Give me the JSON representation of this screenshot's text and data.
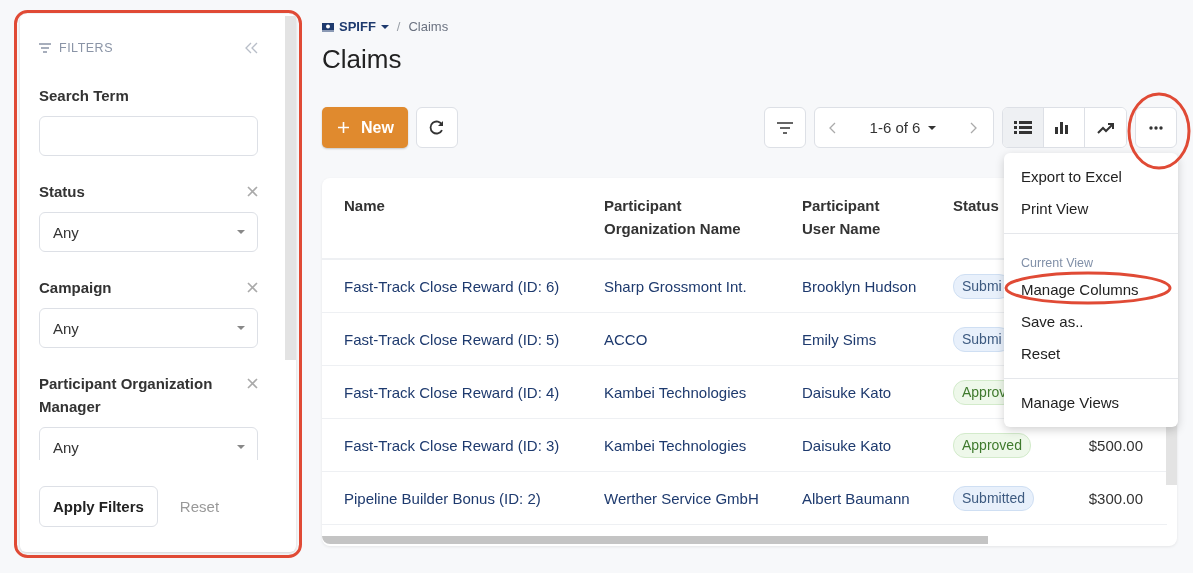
{
  "filters": {
    "title": "FILTERS",
    "fields": [
      {
        "label": "Search Term",
        "kind": "text",
        "clearable": false
      },
      {
        "label": "Status",
        "kind": "select",
        "value": "Any",
        "clearable": true
      },
      {
        "label": "Campaign",
        "kind": "select",
        "value": "Any",
        "clearable": true
      },
      {
        "label": "Participant Organization Manager",
        "kind": "select",
        "value": "Any",
        "clearable": true
      }
    ],
    "apply_button": "Apply Filters",
    "reset_button": "Reset"
  },
  "breadcrumb": {
    "separator": "/",
    "items": [
      {
        "label": "SPIFF",
        "dropdown": true
      },
      {
        "label": "Claims",
        "dropdown": false
      }
    ]
  },
  "page_title": "Claims",
  "toolbar": {
    "new_button": "New",
    "pagination": "1-6 of 6",
    "views": [
      {
        "kind": "list",
        "selected": true
      },
      {
        "kind": "bar",
        "selected": false
      },
      {
        "kind": "trend",
        "selected": false
      }
    ]
  },
  "table": {
    "columns": [
      "Name",
      "Participant Organization Name",
      "Participant User Name",
      "Status"
    ],
    "rows": [
      {
        "name": "Fast-Track Close Reward (ID: 6)",
        "organization": "Sharp Grossmont Int.",
        "user": "Brooklyn Hudson",
        "status": {
          "label": "Submi",
          "kind": "submitted"
        }
      },
      {
        "name": "Fast-Track Close Reward (ID: 5)",
        "organization": "ACCO",
        "user": "Emily Sims",
        "status": {
          "label": "Submi",
          "kind": "submitted"
        }
      },
      {
        "name": "Fast-Track Close Reward (ID: 4)",
        "organization": "Kambei Technologies",
        "user": "Daisuke Kato",
        "status": {
          "label": "Approv",
          "kind": "approved"
        }
      },
      {
        "name": "Fast-Track Close Reward (ID: 3)",
        "organization": "Kambei Technologies",
        "user": "Daisuke Kato",
        "status": {
          "label": "Approved",
          "kind": "approved"
        },
        "amount": "$500.00"
      },
      {
        "name": "Pipeline Builder Bonus (ID: 2)",
        "organization": "Werther Service GmbH",
        "user": "Albert Baumann",
        "status": {
          "label": "Submitted",
          "kind": "submitted"
        },
        "amount": "$300.00"
      }
    ]
  },
  "menu": {
    "items": [
      {
        "kind": "item",
        "label": "Export to Excel"
      },
      {
        "kind": "item",
        "label": "Print View"
      },
      {
        "kind": "divider"
      },
      {
        "kind": "heading",
        "label": "Current View"
      },
      {
        "kind": "item",
        "label": "Manage Columns"
      },
      {
        "kind": "item",
        "label": "Save as.."
      },
      {
        "kind": "item",
        "label": "Reset"
      },
      {
        "kind": "divider"
      },
      {
        "kind": "item",
        "label": "Manage Views"
      }
    ]
  },
  "highlights": [
    {
      "kind": "rectangle"
    },
    {
      "kind": "circle"
    },
    {
      "kind": "ellipse"
    }
  ]
}
